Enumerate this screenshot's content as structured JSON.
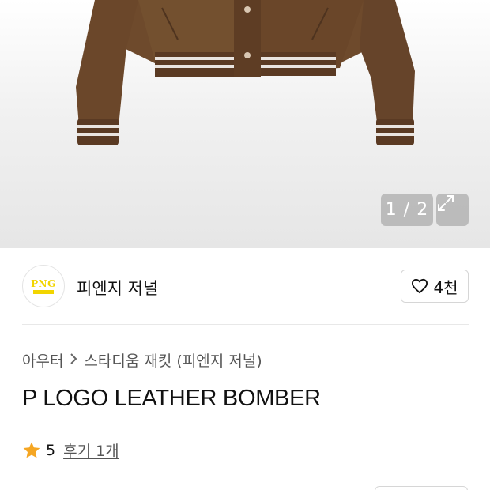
{
  "gallery": {
    "current": "1",
    "separator": "/",
    "total": "2",
    "counter_text": "1 / 2"
  },
  "brand": {
    "logo_text": "PNG",
    "name": "피엔지 저널",
    "like_count": "4천"
  },
  "breadcrumb": {
    "category": "아우터",
    "subcategory": "스타디움 재킷 (피엔지 저널)"
  },
  "product": {
    "title": "P LOGO LEATHER BOMBER"
  },
  "rating": {
    "score": "5",
    "reviews": "후기 1개"
  },
  "colors": {
    "accent_star": "#f5a623",
    "logo_yellow": "#f2d500",
    "leather_brown": "#6e4a2c"
  }
}
